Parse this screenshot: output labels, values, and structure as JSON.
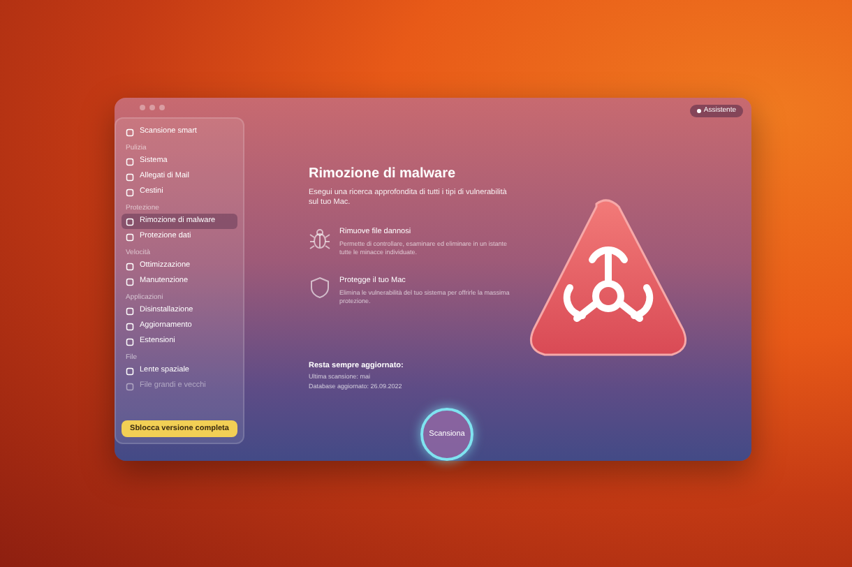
{
  "window": {
    "assistant_button": "Assistente"
  },
  "sidebar": {
    "items": [
      {
        "kind": "item",
        "label": "Scansione smart",
        "selected": false,
        "disabled": false
      },
      {
        "kind": "header",
        "label": "Pulizia"
      },
      {
        "kind": "item",
        "label": "Sistema",
        "selected": false,
        "disabled": false
      },
      {
        "kind": "item",
        "label": "Allegati di Mail",
        "selected": false,
        "disabled": false
      },
      {
        "kind": "item",
        "label": "Cestini",
        "selected": false,
        "disabled": false
      },
      {
        "kind": "header",
        "label": "Protezione"
      },
      {
        "kind": "item",
        "label": "Rimozione di malware",
        "selected": true,
        "disabled": false
      },
      {
        "kind": "item",
        "label": "Protezione dati",
        "selected": false,
        "disabled": false
      },
      {
        "kind": "header",
        "label": "Velocità"
      },
      {
        "kind": "item",
        "label": "Ottimizzazione",
        "selected": false,
        "disabled": false
      },
      {
        "kind": "item",
        "label": "Manutenzione",
        "selected": false,
        "disabled": false
      },
      {
        "kind": "header",
        "label": "Applicazioni"
      },
      {
        "kind": "item",
        "label": "Disinstallazione",
        "selected": false,
        "disabled": false
      },
      {
        "kind": "item",
        "label": "Aggiornamento",
        "selected": false,
        "disabled": false
      },
      {
        "kind": "item",
        "label": "Estensioni",
        "selected": false,
        "disabled": false
      },
      {
        "kind": "header",
        "label": "File"
      },
      {
        "kind": "item",
        "label": "Lente spaziale",
        "selected": false,
        "disabled": false
      },
      {
        "kind": "item",
        "label": "File grandi e vecchi",
        "selected": false,
        "disabled": true
      }
    ],
    "unlock_button": "Sblocca versione completa"
  },
  "main": {
    "title": "Rimozione di malware",
    "description": "Esegui una ricerca approfondita di tutti i tipi di vulnerabilità sul tuo Mac.",
    "features": [
      {
        "kind": "bug",
        "title": "Rimuove file dannosi",
        "text": "Permette di controllare, esaminare ed eliminare in un istante tutte le minacce individuate."
      },
      {
        "kind": "shield",
        "title": "Protegge il tuo Mac",
        "text": "Elimina le vulnerabilità del tuo sistema per offrirle la massima protezione."
      }
    ],
    "status_title": "Resta sempre aggiornato:",
    "status_lines": [
      "Ultima scansione: mai",
      "Database aggiornato: 26.09.2022"
    ],
    "scan_button": "Scansiona"
  }
}
